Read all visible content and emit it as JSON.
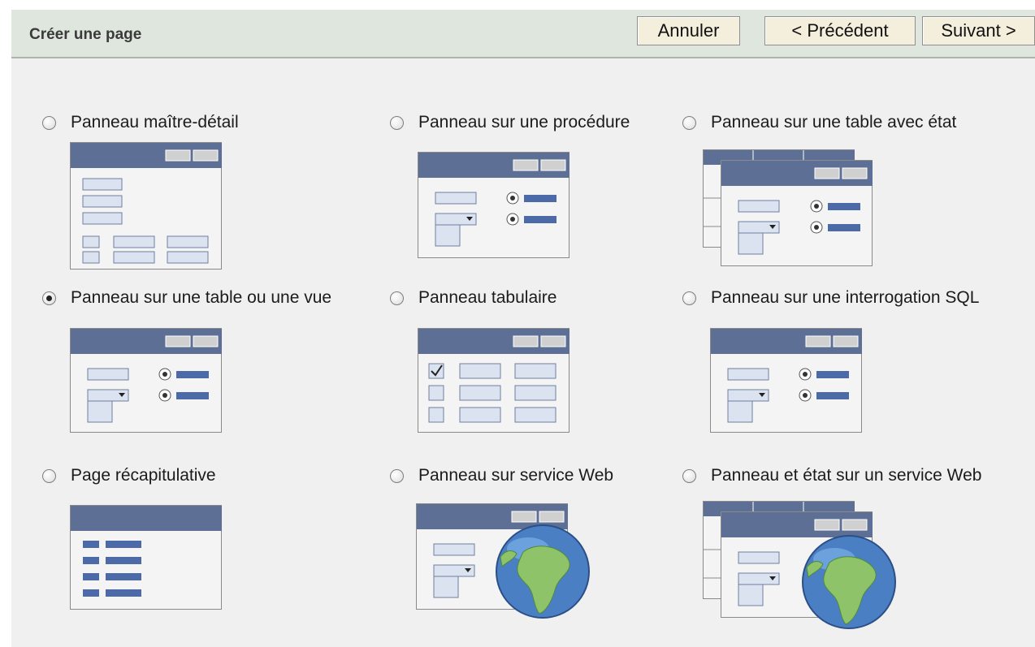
{
  "wizard": {
    "title": "Créer une page",
    "buttons": {
      "cancel": "Annuler",
      "previous": "< Précédent",
      "next": "Suivant >"
    }
  },
  "options": [
    {
      "label": "Panneau maître-détail",
      "selected": false
    },
    {
      "label": "Panneau sur une procédure",
      "selected": false
    },
    {
      "label": "Panneau sur une table avec état",
      "selected": false
    },
    {
      "label": "Panneau sur une table ou une vue",
      "selected": true
    },
    {
      "label": "Panneau tabulaire",
      "selected": false
    },
    {
      "label": "Panneau sur une interrogation SQL",
      "selected": false
    },
    {
      "label": "Page récapitulative",
      "selected": false
    },
    {
      "label": "Panneau sur service Web",
      "selected": false
    },
    {
      "label": "Panneau et état sur un service Web",
      "selected": false
    }
  ],
  "colors": {
    "header_band": "#dfe6de",
    "window_title_bar": "#5d6f95",
    "field_fill": "#dbe3f0",
    "globe_sea": "#4b7fc4",
    "globe_land": "#8fc36a"
  }
}
